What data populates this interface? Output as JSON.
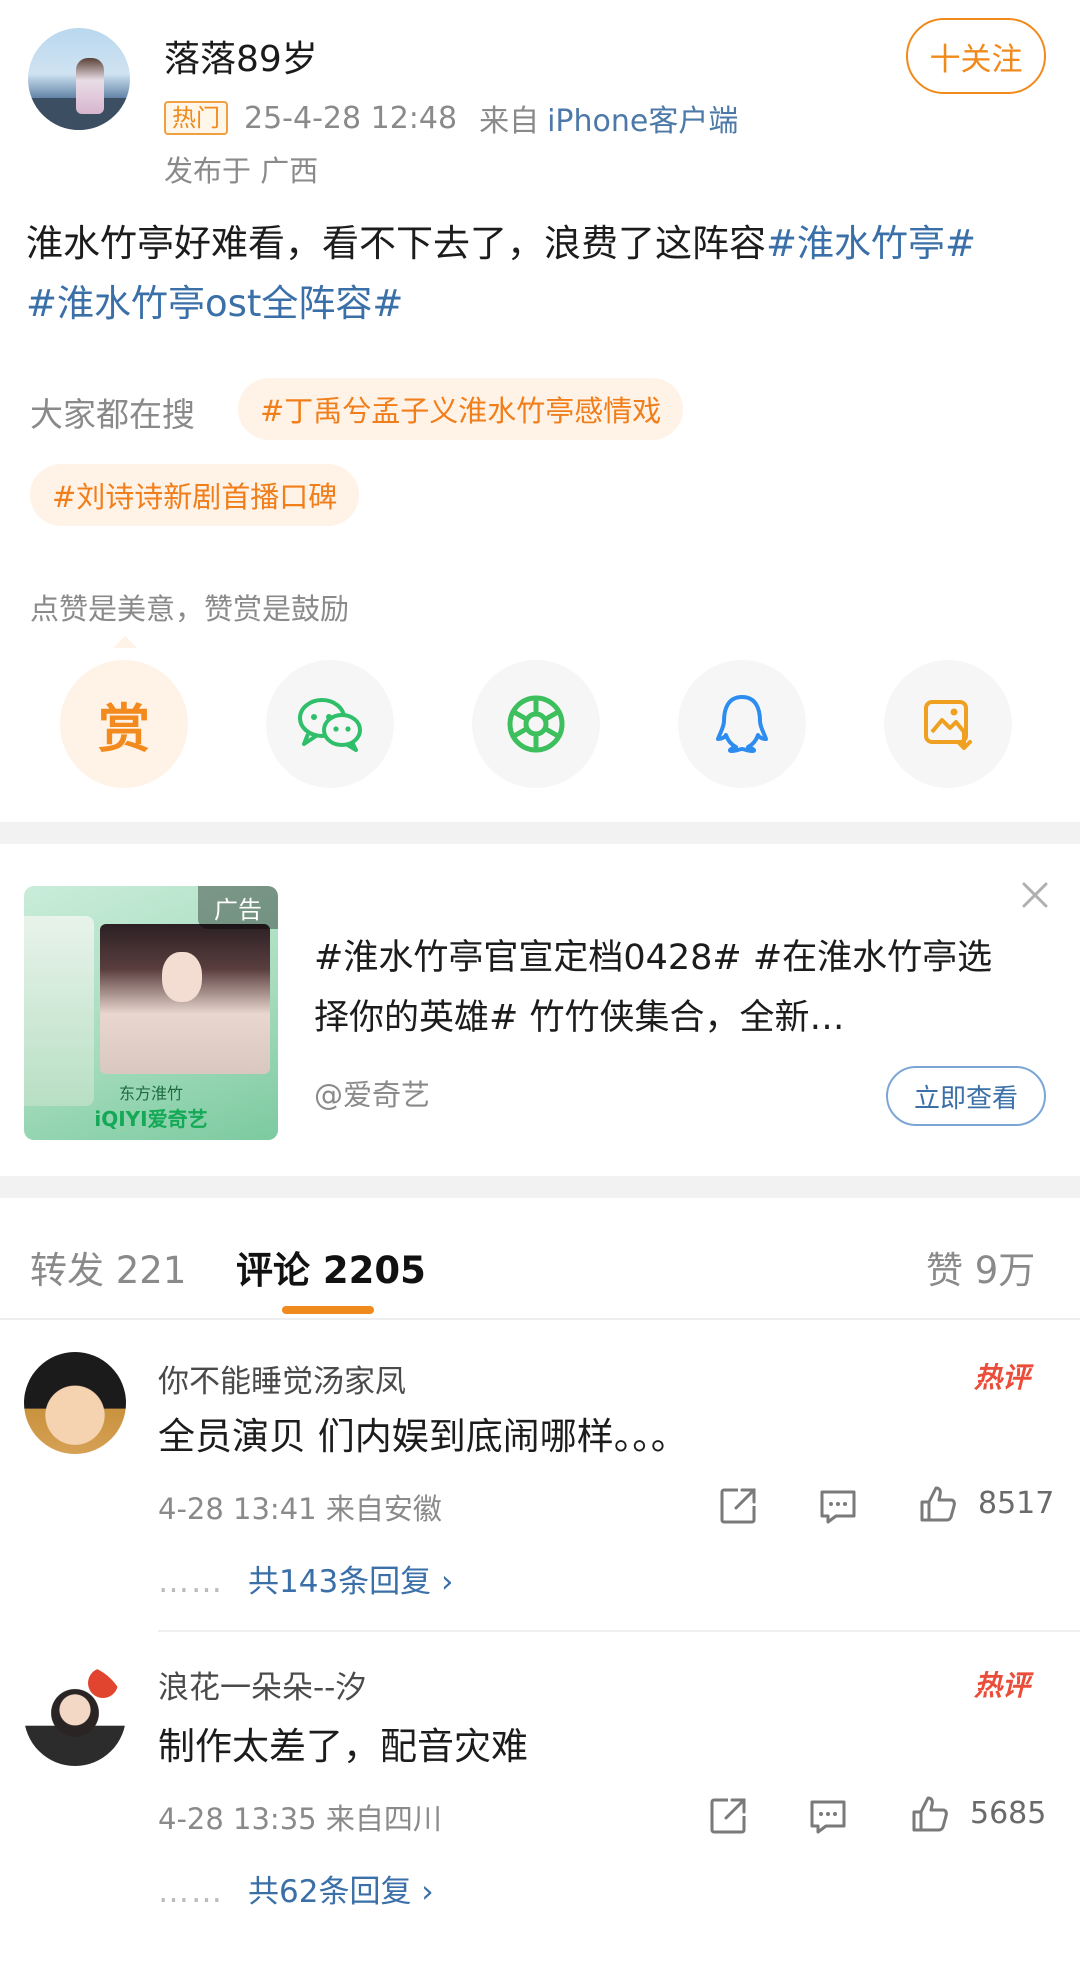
{
  "post": {
    "username": "落落89岁",
    "hot_badge": "热门",
    "time": "25-4-28 12:48",
    "source_prefix": "来自",
    "source_app": "iPhone客户端",
    "location": "发布于 广西",
    "follow_label": "十关注",
    "text_plain": "淮水竹亭好难看，看不下去了，浪费了这阵容",
    "tag_1": "#淮水竹亭#",
    "tag_2": "#淮水竹亭ost全阵容#"
  },
  "search": {
    "label": "大家都在搜",
    "chips": [
      "#丁禹兮孟子义淮水竹亭感情戏",
      "#刘诗诗新剧首播口碑"
    ]
  },
  "reward": {
    "caption": "点赞是美意，赞赏是鼓励",
    "button_char": "赏"
  },
  "share_icons": [
    "reward-icon",
    "wechat-icon",
    "moments-icon",
    "qq-icon",
    "save-image-icon"
  ],
  "ad": {
    "badge": "广告",
    "title": "#淮水竹亭官宣定档0428# #在淮水竹亭选择你的英雄# 竹竹侠集合，全新…",
    "source": "@爱奇艺",
    "cta": "立即查看",
    "image_caption": "东方淮竹",
    "image_logo": "iQIYI爱奇艺"
  },
  "tabs": {
    "repost": "转发 221",
    "comments": "评论 2205",
    "likes": "赞 9万"
  },
  "comments": [
    {
      "name": "你不能睡觉汤家凤",
      "hot": "热评",
      "text": "全员演贝 们内娱到底闹哪样。。。",
      "time": "4-28 13:41  来自安徽",
      "likes": "8517",
      "replies": "共143条回复 ›"
    },
    {
      "name": "浪花一朵朵--汐",
      "hot": "热评",
      "text": "制作太差了，配音灾难",
      "time": "4-28 13:35  来自四川",
      "likes": "5685",
      "replies": "共62条回复 ›"
    }
  ],
  "ui": {
    "dots": "……"
  },
  "colors": {
    "accent": "#f08a1c",
    "link": "#3a6fa8",
    "muted": "#8a8a8a",
    "hot": "#ea4d3a"
  }
}
